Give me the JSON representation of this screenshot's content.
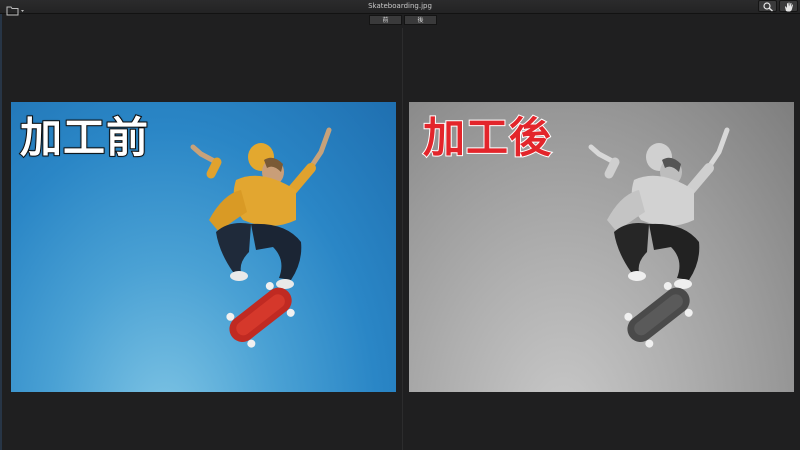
{
  "window": {
    "title": "Skateboarding.jpg"
  },
  "toolbar": {
    "left_icon": "folder-icon",
    "right_icons": [
      "magnifier-icon",
      "hand-icon"
    ]
  },
  "mode_tabs": [
    {
      "label": "前"
    },
    {
      "label": "後"
    }
  ],
  "panels": {
    "before": {
      "label": "加工前",
      "color_mode": "color",
      "label_color": "#ffffff"
    },
    "after": {
      "label": "加工後",
      "color_mode": "grayscale",
      "label_color": "#e3252b"
    }
  },
  "colors": {
    "background": "#1f1f20",
    "sky_blue": "#2a86c6",
    "accent_red": "#e3252b"
  }
}
